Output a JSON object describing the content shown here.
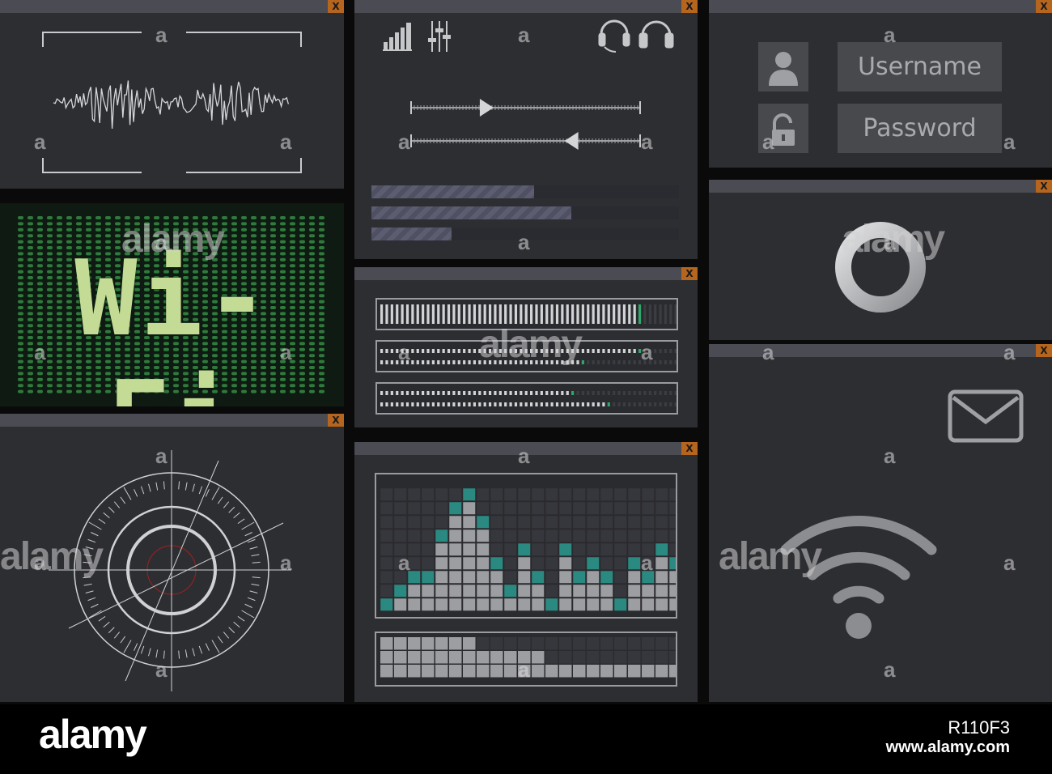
{
  "close_label": "X",
  "login": {
    "username_placeholder": "Username",
    "password_placeholder": "Password"
  },
  "wifi_banner": {
    "text": "Wi-Fi"
  },
  "mixer": {
    "slider1_level": 0.3,
    "slider2_level": 0.73,
    "progress": [
      0.53,
      0.65,
      0.26
    ]
  },
  "meters": [
    {
      "levels": [
        0.87
      ]
    },
    {
      "levels": [
        0.87,
        0.68
      ]
    },
    {
      "levels": [
        0.63,
        0.75
      ]
    }
  ],
  "equalizer": {
    "columns": [
      1,
      2,
      3,
      3,
      6,
      8,
      9,
      7,
      4,
      2,
      5,
      3,
      1,
      5,
      3,
      4,
      3,
      1,
      4,
      3,
      5,
      4
    ]
  },
  "spectrum": {
    "columns": [
      3,
      3,
      3,
      3,
      3,
      3,
      3,
      2,
      2,
      2,
      2,
      2,
      1,
      1,
      1,
      1,
      1,
      1,
      1,
      1,
      1,
      1
    ]
  },
  "watermark": {
    "brand": "alamy",
    "letter": "a",
    "image_id": "R110F3",
    "site": "www.alamy.com"
  },
  "icons": {
    "signal": "signal-bars-icon",
    "sliders": "sliders-icon",
    "headset": "headset-icon",
    "headphones": "headphones-icon",
    "user": "user-icon",
    "lock": "unlock-icon",
    "ring": "ring-icon",
    "mail": "mail-icon",
    "wifi": "wifi-icon",
    "radar": "radar-icon",
    "wave": "waveform-icon"
  },
  "colors": {
    "panel": "#2d2e32",
    "titlebar": "#4a4b53",
    "close": "#b5651d",
    "matrix_bg": "#13321a",
    "teal": "#2a8a82",
    "cell": "#9d9ea2"
  }
}
